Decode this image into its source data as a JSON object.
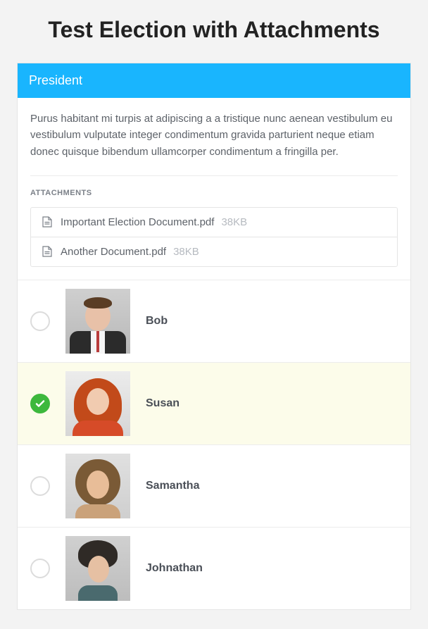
{
  "page_title": "Test Election with Attachments",
  "ballot": {
    "position": "President",
    "description": "Purus habitant mi turpis at adipiscing a a tristique nunc aenean vestibulum eu vestibulum vulputate integer condimentum gravida parturient neque etiam donec quisque bibendum ullamcorper condimentum a fringilla per.",
    "attachments_label": "ATTACHMENTS",
    "attachments": [
      {
        "name": "Important Election Document.pdf",
        "size": "38KB"
      },
      {
        "name": "Another Document.pdf",
        "size": "38KB"
      }
    ],
    "candidates": [
      {
        "name": "Bob",
        "selected": false
      },
      {
        "name": "Susan",
        "selected": true
      },
      {
        "name": "Samantha",
        "selected": false
      },
      {
        "name": "Johnathan",
        "selected": false
      }
    ]
  }
}
